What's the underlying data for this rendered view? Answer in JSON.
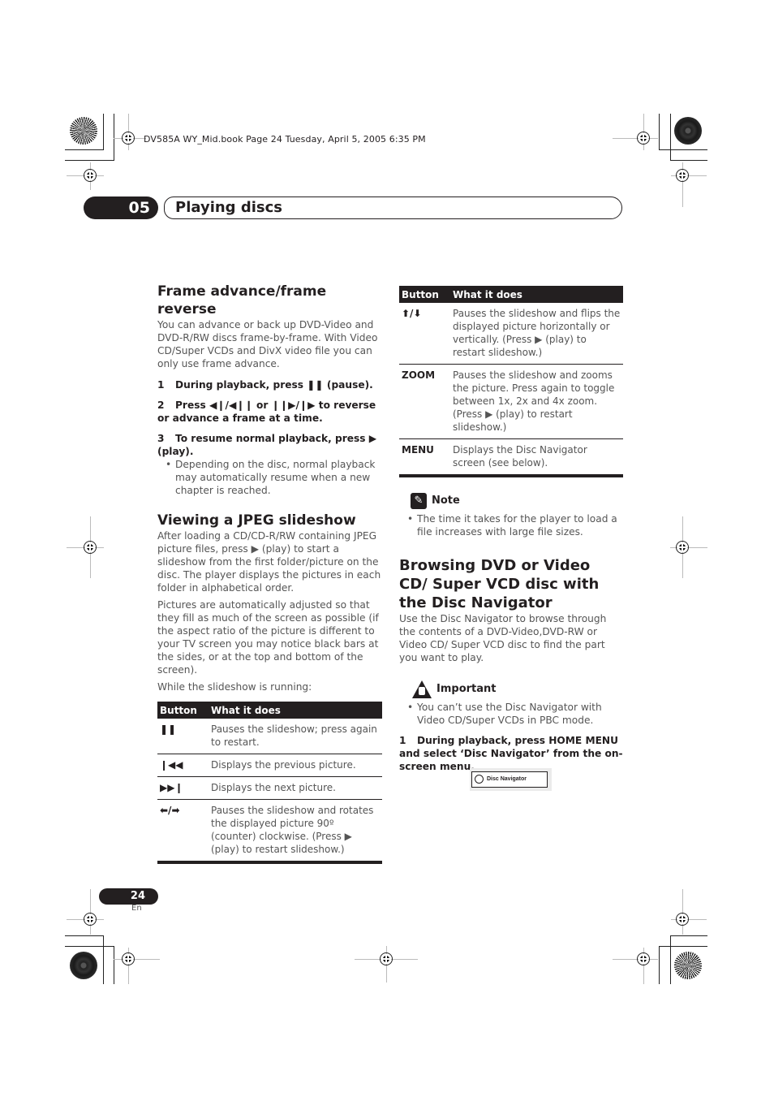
{
  "print_header": "DV585A WY_Mid.book  Page 24  Tuesday, April 5, 2005  6:35 PM",
  "chapter": {
    "number": "05",
    "title": "Playing discs"
  },
  "left_column": {
    "frame_section": {
      "heading": "Frame advance/frame reverse",
      "intro": "You can advance or back up DVD-Video and DVD-R/RW discs frame-by-frame. With Video CD/Super VCDs and DivX video file you can only use frame advance.",
      "steps": [
        {
          "num": "1",
          "text": "During playback, press ❚❚ (pause)."
        },
        {
          "num": "2",
          "text": "Press ◀❙/◀❙❙ or ❙❙▶/❙▶ to reverse or advance a frame at a time."
        },
        {
          "num": "3",
          "text": "To resume normal playback, press ▶ (play)."
        }
      ],
      "bullet": "Depending on the disc, normal playback may automatically resume when a new chapter is reached."
    },
    "jpeg_section": {
      "heading": "Viewing a JPEG slideshow",
      "paragraphs": [
        "After loading a CD/CD-R/RW containing JPEG picture files, press ▶ (play) to start a slideshow from the first folder/picture on the disc. The player displays the pictures in each folder in alphabetical order.",
        "Pictures are automatically adjusted so that they fill as much of the screen as possible (if the aspect ratio of the picture is different to your TV screen you may notice black bars at the sides, or at the top and bottom of the screen).",
        "While the slideshow is running:"
      ],
      "table": {
        "headers": [
          "Button",
          "What it does"
        ],
        "rows": [
          {
            "button": "❚❚",
            "icon": "pause-icon",
            "desc": "Pauses the slideshow; press again to restart."
          },
          {
            "button": "❙◀◀",
            "icon": "previous-icon",
            "desc": "Displays the previous picture."
          },
          {
            "button": "▶▶❙",
            "icon": "next-icon",
            "desc": "Displays the next picture."
          },
          {
            "button": "⬅/➡",
            "icon": "left-right-arrows-icon",
            "desc": "Pauses the slideshow and rotates the displayed picture 90º (counter) clockwise. (Press ▶ (play) to restart slideshow.)"
          }
        ]
      }
    }
  },
  "right_column": {
    "table": {
      "headers": [
        "Button",
        "What it does"
      ],
      "rows": [
        {
          "button": "⬆/⬇",
          "icon": "up-down-arrows-icon",
          "desc": "Pauses the slideshow and flips the displayed picture horizontally or vertically. (Press ▶ (play) to restart slideshow.)"
        },
        {
          "button": "ZOOM",
          "icon": "",
          "desc": "Pauses the slideshow and zooms the picture. Press again to toggle between 1x, 2x and 4x zoom. (Press ▶ (play) to restart slideshow.)"
        },
        {
          "button": "MENU",
          "icon": "",
          "desc": "Displays the Disc Navigator screen (see below)."
        }
      ]
    },
    "note": {
      "title": "Note",
      "bullet": "The time it takes for the player to load a file increases with large file sizes."
    },
    "browse_section": {
      "heading": "Browsing DVD or Video CD/ Super VCD disc with the Disc Navigator",
      "intro": "Use the Disc Navigator to browse through the contents of a DVD-Video,DVD-RW or Video CD/ Super VCD disc to find the part you want to play.",
      "important": {
        "title": "Important",
        "bullet": "You can’t use the Disc Navigator with Video CD/Super VCDs in PBC mode."
      },
      "step": {
        "num": "1",
        "text": "During playback, press HOME MENU and select ‘Disc Navigator’ from the on-screen menu."
      },
      "osd_label": "Disc Navigator"
    }
  },
  "footer": {
    "page_number": "24",
    "language": "En"
  }
}
